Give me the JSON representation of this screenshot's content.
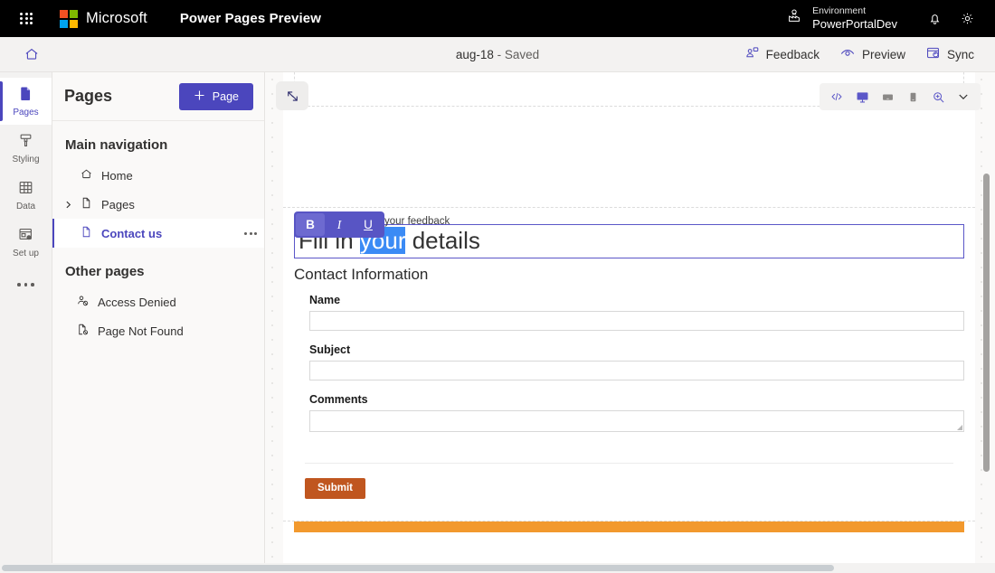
{
  "topbar": {
    "waffle_label": "App launcher",
    "brand": "Microsoft",
    "app_name": "Power Pages Preview",
    "environment_label": "Environment",
    "environment_value": "PowerPortalDev",
    "notifications_label": "Notifications",
    "settings_label": "Settings"
  },
  "commandbar": {
    "home_label": "Home",
    "doc_name": "aug-18",
    "doc_status": " - Saved",
    "actions": [
      {
        "label": "Feedback",
        "icon": "feedback-icon"
      },
      {
        "label": "Preview",
        "icon": "eye-icon"
      },
      {
        "label": "Sync",
        "icon": "sync-icon"
      }
    ]
  },
  "rail": {
    "items": [
      {
        "label": "Pages",
        "icon": "page-icon",
        "active": true
      },
      {
        "label": "Styling",
        "icon": "brush-icon",
        "active": false
      },
      {
        "label": "Data",
        "icon": "table-icon",
        "active": false
      },
      {
        "label": "Set up",
        "icon": "setup-icon",
        "active": false
      }
    ],
    "more_label": "More"
  },
  "panel": {
    "title": "Pages",
    "new_page_button": "Page",
    "main_nav_title": "Main navigation",
    "main_nav_items": [
      {
        "label": "Home",
        "icon": "home-icon",
        "selected": false,
        "expandable": false
      },
      {
        "label": "Pages",
        "icon": "file-icon",
        "selected": false,
        "expandable": true
      },
      {
        "label": "Contact us",
        "icon": "file-icon",
        "selected": true,
        "expandable": false
      }
    ],
    "other_pages_title": "Other pages",
    "other_pages_items": [
      {
        "label": "Access Denied",
        "icon": "access-denied-icon"
      },
      {
        "label": "Page Not Found",
        "icon": "page-not-found-icon"
      }
    ]
  },
  "canvas": {
    "expand_label": "Expand canvas",
    "toolbar": [
      {
        "name": "code-icon",
        "label": "Code editor",
        "state": "default"
      },
      {
        "name": "desktop-icon",
        "label": "Desktop view",
        "state": "active"
      },
      {
        "name": "tablet-icon",
        "label": "Tablet view",
        "state": "default"
      },
      {
        "name": "mobile-icon",
        "label": "Mobile view",
        "state": "default"
      },
      {
        "name": "zoom-in-icon",
        "label": "Zoom",
        "state": "default"
      },
      {
        "name": "chevron-down-icon",
        "label": "More view options",
        "state": "default"
      }
    ]
  },
  "editor": {
    "rte": {
      "bold": "B",
      "italic": "I",
      "underline": "U",
      "bold_active": true
    },
    "ghost_text": "your feedback",
    "heading": {
      "before": "Fill in ",
      "selected": "your",
      "after": " details"
    },
    "form": {
      "legend": "Contact Information",
      "fields": [
        {
          "label": "Name",
          "value": "",
          "type": "text"
        },
        {
          "label": "Subject",
          "value": "",
          "type": "text"
        },
        {
          "label": "Comments",
          "value": "",
          "type": "textarea"
        }
      ],
      "submit_label": "Submit"
    }
  },
  "colors": {
    "accent": "#4b46bd",
    "rte_toolbar": "#5855c4",
    "selection": "#3b8bf5",
    "submit": "#c0561f",
    "footer_bar": "#f2992e",
    "topbar": "#000000"
  }
}
